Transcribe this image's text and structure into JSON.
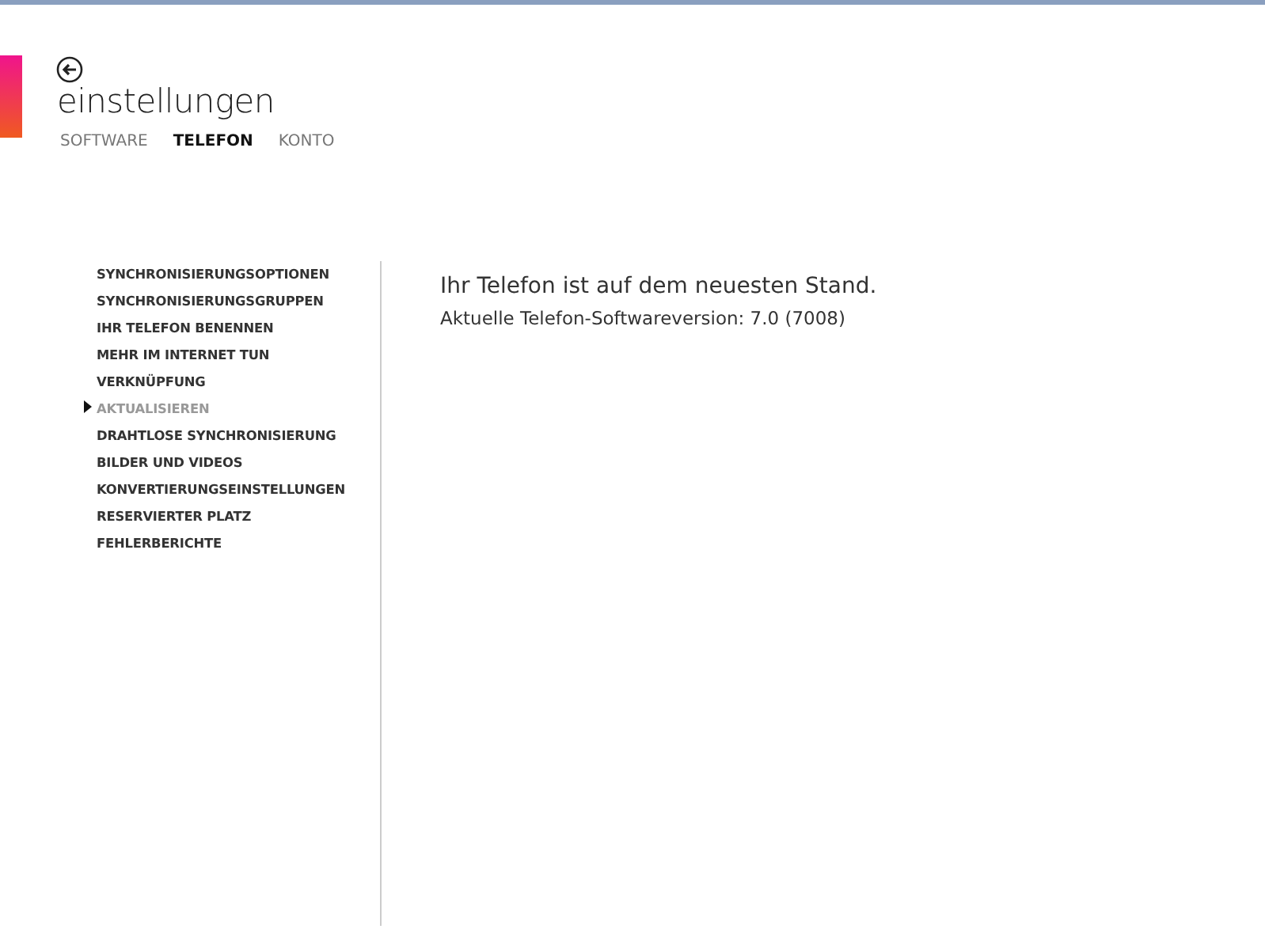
{
  "header": {
    "title": "einstellungen"
  },
  "tabs": [
    {
      "label": "SOFTWARE",
      "selected": false
    },
    {
      "label": "TELEFON",
      "selected": true
    },
    {
      "label": "KONTO",
      "selected": false
    }
  ],
  "sidebar": {
    "items": [
      {
        "label": "SYNCHRONISIERUNGSOPTIONEN",
        "selected": false
      },
      {
        "label": "SYNCHRONISIERUNGSGRUPPEN",
        "selected": false
      },
      {
        "label": "IHR TELEFON BENENNEN",
        "selected": false
      },
      {
        "label": "MEHR IM INTERNET TUN",
        "selected": false
      },
      {
        "label": "VERKNÜPFUNG",
        "selected": false
      },
      {
        "label": "AKTUALISIEREN",
        "selected": true
      },
      {
        "label": "DRAHTLOSE SYNCHRONISIERUNG",
        "selected": false
      },
      {
        "label": "BILDER UND VIDEOS",
        "selected": false
      },
      {
        "label": "KONVERTIERUNGSEINSTELLUNGEN",
        "selected": false
      },
      {
        "label": "RESERVIERTER PLATZ",
        "selected": false
      },
      {
        "label": "FEHLERBERICHTE",
        "selected": false
      }
    ]
  },
  "content": {
    "heading": "Ihr Telefon ist auf dem neuesten Stand.",
    "version": "Aktuelle Telefon-Softwareversion: 7.0 (7008)"
  }
}
